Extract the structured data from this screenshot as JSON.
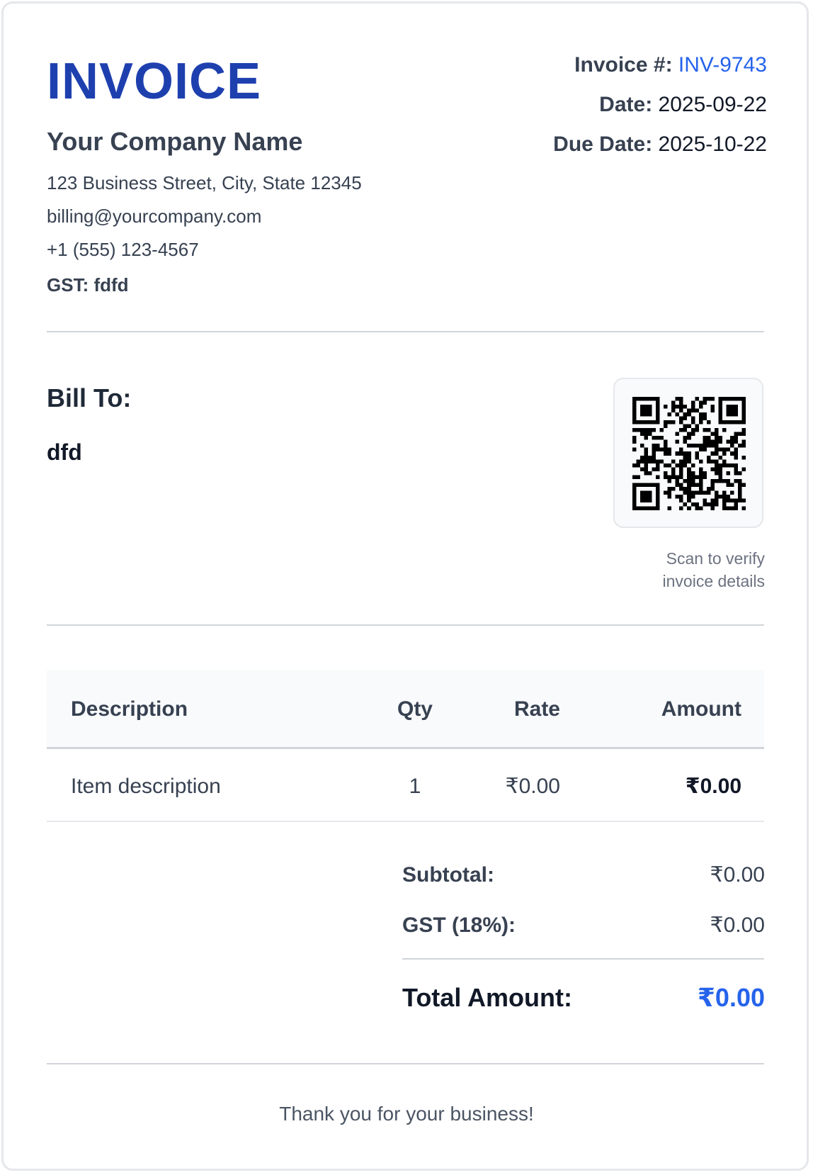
{
  "header": {
    "title": "INVOICE",
    "invoice_number_label": "Invoice #:",
    "invoice_number": "INV-9743",
    "date_label": "Date:",
    "date": "2025-09-22",
    "due_date_label": "Due Date:",
    "due_date": "2025-10-22"
  },
  "company": {
    "name": "Your Company Name",
    "address": "123 Business Street, City, State 12345",
    "email": "billing@yourcompany.com",
    "phone": "+1 (555) 123-4567",
    "gst": "GST: fdfd"
  },
  "bill_to": {
    "label": "Bill To:",
    "name": "dfd"
  },
  "qr": {
    "icon": "qr-code-icon",
    "caption_line1": "Scan to verify",
    "caption_line2": "invoice details"
  },
  "table": {
    "headers": [
      "Description",
      "Qty",
      "Rate",
      "Amount"
    ],
    "rows": [
      [
        "Item description",
        "1",
        "₹0.00",
        "₹0.00"
      ]
    ]
  },
  "summary": {
    "subtotal_label": "Subtotal:",
    "subtotal": "₹0.00",
    "gst_label": "GST (18%):",
    "gst": "₹0.00",
    "total_label": "Total Amount:",
    "total": "₹0.00"
  },
  "footer": {
    "thanks": "Thank you for your business!"
  },
  "colors": {
    "brand": "#1e40af",
    "accent": "#2563eb",
    "text": "#374151",
    "divider": "#d1d5db"
  }
}
